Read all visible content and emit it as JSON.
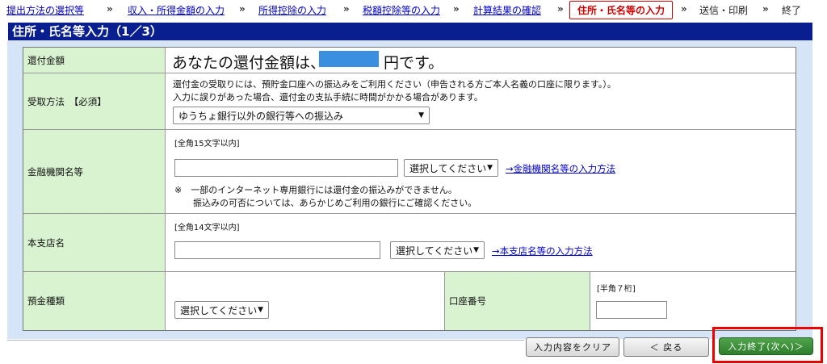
{
  "steps": [
    {
      "label": "提出方法の選択等"
    },
    {
      "label": "収入・所得金額の入力"
    },
    {
      "label": "所得控除の入力"
    },
    {
      "label": "税額控除等の入力"
    },
    {
      "label": "計算結果の確認"
    },
    {
      "label": "住所・氏名等の入力"
    },
    {
      "label": "送信・印刷"
    },
    {
      "label": "終了"
    }
  ],
  "step_separator": "»",
  "page_title": "住所・氏名等入力（1／3）",
  "rows": {
    "refund": {
      "label": "還付金額",
      "text_prefix": "あなたの還付金額は、",
      "text_suffix": "円です。"
    },
    "method": {
      "label": "受取方法　【必須】",
      "note1": "還付金の受取りには、預貯金口座への振込みをご利用ください（申告される方ご本人名義の口座に限ります。）。",
      "note2": "入力に誤りがあった場合、還付金の支払手続に時間がかかる場合があります。",
      "selected": "ゆうちょ銀行以外の銀行等への振込み"
    },
    "bank": {
      "label": "金融機関名等",
      "limit": "[全角15文字以内]",
      "select": "選択してください",
      "link": "→金融機関名等の入力方法",
      "warn1": "※　一部のインターネット専用銀行には還付金の振込みができません。",
      "warn2": "振込みの可否については、あらかじめご利用の銀行にご確認ください。"
    },
    "branch": {
      "label": "本支店名",
      "limit": "[全角14文字以内]",
      "select": "選択してください",
      "link": "→本支店名等の入力方法"
    },
    "deposit": {
      "label": "預金種類",
      "select": "選択してください",
      "account_label": "口座番号",
      "account_limit": "[半角７桁]"
    }
  },
  "buttons": {
    "clear": "入力内容をクリア",
    "back": "＜ 戻る",
    "next": "入力終了(次へ)＞"
  },
  "colors": {
    "title_bg": "#0a1f8f",
    "label_bg": "#d9f2d0",
    "current_step": "#cc0000",
    "next_button": "#2f7d2d",
    "highlight": "#ee0000"
  }
}
